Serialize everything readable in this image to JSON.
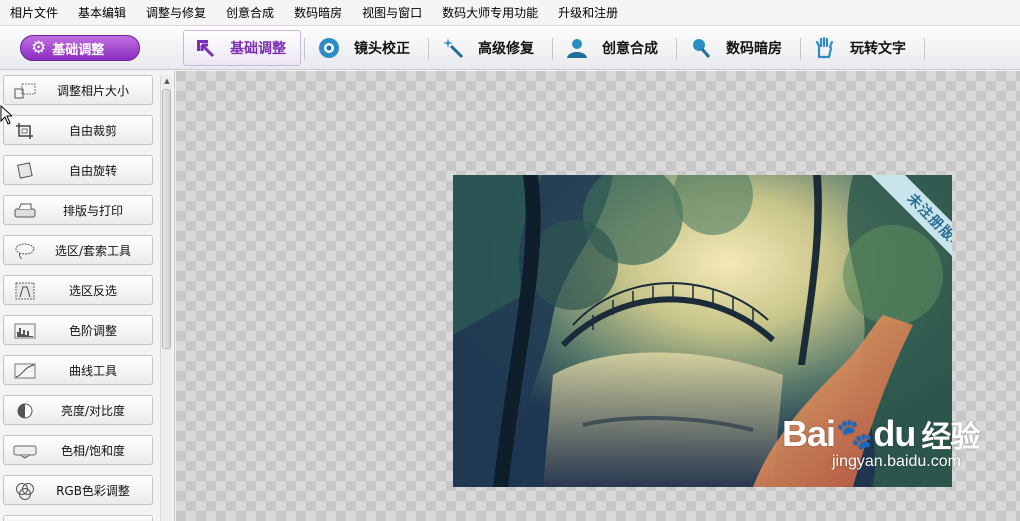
{
  "menu": [
    "相片文件",
    "基本编辑",
    "调整与修复",
    "创意合成",
    "数码暗房",
    "视图与窗口",
    "数码大师专用功能",
    "升级和注册"
  ],
  "toolbar": {
    "brand_label": "基础调整",
    "tabs": [
      {
        "label": "基础调整",
        "icon": "crop-arrow-icon",
        "active": true
      },
      {
        "label": "镜头校正",
        "icon": "lens-icon",
        "active": false
      },
      {
        "label": "高级修复",
        "icon": "magic-wand-icon",
        "active": false
      },
      {
        "label": "创意合成",
        "icon": "person-icon",
        "active": false
      },
      {
        "label": "数码暗房",
        "icon": "brush-icon",
        "active": false
      },
      {
        "label": "玩转文字",
        "icon": "hand-text-icon",
        "active": false
      }
    ],
    "accent_color": "#7a2fb5"
  },
  "tools": [
    {
      "label": "调整相片大小",
      "icon": "resize-icon"
    },
    {
      "label": "自由裁剪",
      "icon": "crop-icon"
    },
    {
      "label": "自由旋转",
      "icon": "rotate-icon"
    },
    {
      "label": "排版与打印",
      "icon": "printer-icon"
    },
    {
      "label": "选区/套索工具",
      "icon": "lasso-icon"
    },
    {
      "label": "选区反选",
      "icon": "invert-selection-icon"
    },
    {
      "label": "色阶调整",
      "icon": "levels-icon"
    },
    {
      "label": "曲线工具",
      "icon": "curves-icon"
    },
    {
      "label": "亮度/对比度",
      "icon": "brightness-icon"
    },
    {
      "label": "色相/饱和度",
      "icon": "hue-icon"
    },
    {
      "label": "RGB色彩调整",
      "icon": "rgb-icon"
    }
  ],
  "canvas": {
    "ribbon_text": "未注册版本"
  },
  "watermark": {
    "brand_left": "Bai",
    "brand_right": "du",
    "brand_cn": "经验",
    "url": "jingyan.baidu.com"
  }
}
